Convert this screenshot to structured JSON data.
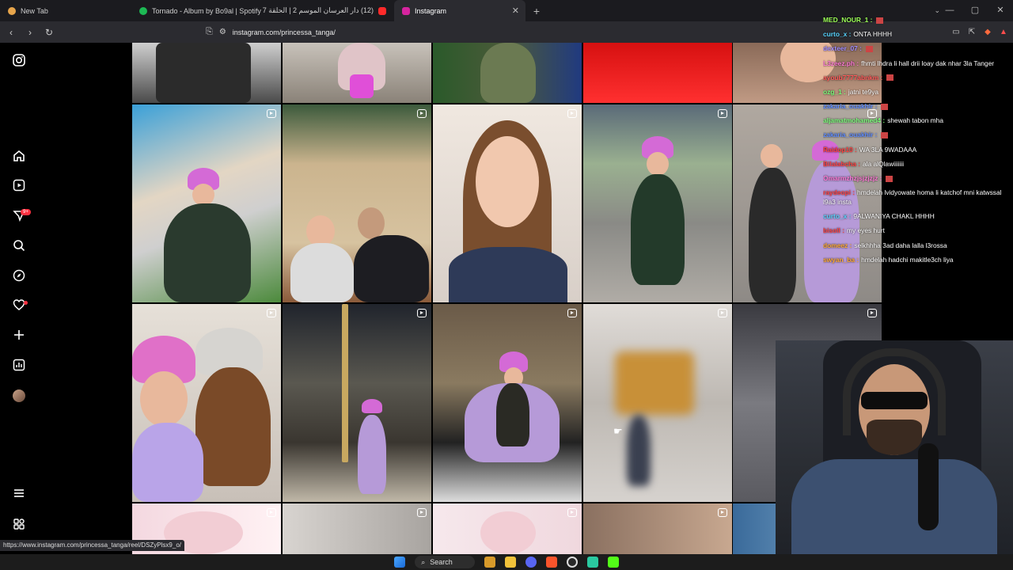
{
  "browser": {
    "tabs": [
      {
        "title": "New Tab",
        "favicon_color": "#e7a54b",
        "active": false
      },
      {
        "title": "Tornado - Album by Bo9al | Spotify",
        "favicon_color": "#1db954",
        "active": false
      },
      {
        "title": "(12) دار العرسان الموسم 2 | الحلقة 7",
        "favicon_color": "#ff2a2a",
        "active": false
      },
      {
        "title": "Instagram",
        "favicon_color": "#d6249f",
        "active": true
      }
    ],
    "new_tab_label": "+",
    "tab_close_label": "✕",
    "address": "instagram.com/princessa_tanga/",
    "status_url": "https://www.instagram.com/princessa_tanga/reel/DSZyPlsx9_o/"
  },
  "sidebar": {
    "icons": [
      "instagram-icon",
      "home-icon",
      "reels-icon",
      "messages-icon",
      "search-icon",
      "explore-icon",
      "notifications-icon",
      "create-icon",
      "dashboard-icon",
      "profile-avatar",
      "more-menu-icon",
      "also-from-meta-icon"
    ],
    "messages_badge": "9+"
  },
  "chat": {
    "messages": [
      {
        "user": "MED_NOUR_1 :",
        "text": "",
        "color": "#9cff57"
      },
      {
        "user": "curto_x :",
        "text": "ONTA HHHH",
        "color": "#58d4ff"
      },
      {
        "user": "dexteer_07 :",
        "text": "",
        "color": "#a08cff"
      },
      {
        "user": "L3zeez.ph :",
        "text": "fhmti lhdra li hall drii loay dak nhar 3la Tanger",
        "color": "#ff7ad6",
        "wrap": true
      },
      {
        "user": "ayoub7777abnkm :",
        "text": "",
        "color": "#ff5a5a"
      },
      {
        "user": "ozg_1 :",
        "text": "jatni te9ya",
        "color": "#7cff7c"
      },
      {
        "user": "zakaria_ouakhir :",
        "text": "",
        "color": "#5f8cff"
      },
      {
        "user": "aljamatmohamed4 :",
        "text": "shewah tabon mha",
        "color": "#7cff7c"
      },
      {
        "user": "zakaria_ouakhir :",
        "text": "",
        "color": "#5f8cff"
      },
      {
        "user": "Raidop10 :",
        "text": "WA 3LA 9WADAAA",
        "color": "#ff4040"
      },
      {
        "user": "Bilalabcha :",
        "text": "ala alQlawiiiiiii",
        "color": "#ff4040"
      },
      {
        "user": "Omarmzhzjsjzjzjz :",
        "text": "",
        "color": "#ff7ad6"
      },
      {
        "user": "raydeopi :",
        "text": "hmdelah lvidyowate homa li katchof mni katwssal l9a3 insta",
        "color": "#ff4040",
        "wrap": true
      },
      {
        "user": "curto_x :",
        "text": "9ALWANIYA CHAKL HHHH",
        "color": "#58d4ff"
      },
      {
        "user": "bisoll :",
        "text": "my eyes hurt",
        "color": "#ff4040"
      },
      {
        "user": "domeez :",
        "text": "selkhhha 3ad daha lalla l3rossa",
        "color": "#ffaa33"
      },
      {
        "user": "swyan_ba :",
        "text": "hmdelah hadchi makitle3ch liya",
        "color": "#ffaa33"
      }
    ]
  },
  "grid": {
    "reel_icon": "reel-icon"
  },
  "taskbar": {
    "search_label": "Search"
  }
}
